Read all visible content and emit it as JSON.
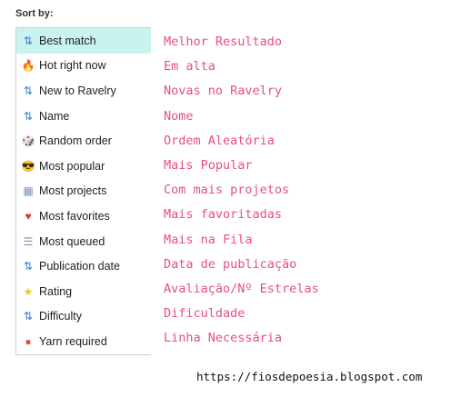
{
  "sort": {
    "label": "Sort by:",
    "selected_index": 0,
    "options": [
      {
        "label": "Best match",
        "icon": "best-match-icon",
        "glyph": "⇅"
      },
      {
        "label": "Hot right now",
        "icon": "fire-icon",
        "glyph": "🔥"
      },
      {
        "label": "New to Ravelry",
        "icon": "new-sort-icon",
        "glyph": "⇅"
      },
      {
        "label": "Name",
        "icon": "alpha-sort-icon",
        "glyph": "⇅"
      },
      {
        "label": "Random order",
        "icon": "dice-icon",
        "glyph": "🎲"
      },
      {
        "label": "Most popular",
        "icon": "sunglasses-face-icon",
        "glyph": "😎"
      },
      {
        "label": "Most projects",
        "icon": "projects-icon",
        "glyph": "▦"
      },
      {
        "label": "Most favorites",
        "icon": "heart-icon",
        "glyph": "♥"
      },
      {
        "label": "Most queued",
        "icon": "queue-icon",
        "glyph": "☰"
      },
      {
        "label": "Publication date",
        "icon": "date-sort-icon",
        "glyph": "⇅"
      },
      {
        "label": "Rating",
        "icon": "star-icon",
        "glyph": "★"
      },
      {
        "label": "Difficulty",
        "icon": "difficulty-sort-icon",
        "glyph": "⇅"
      },
      {
        "label": "Yarn required",
        "icon": "yarn-ball-icon",
        "glyph": "●"
      }
    ]
  },
  "translations": [
    "Melhor Resultado",
    "Em alta",
    "Novas no Ravelry",
    "Nome",
    "Ordem Aleatória",
    "Mais Popular",
    "Com mais projetos",
    "Mais favoritadas",
    "Mais na Fila",
    "Data de publicação",
    "Avaliação/Nº Estrelas",
    "Dificuldade",
    "Linha Necessária"
  ],
  "source_url": "https://fiosdepoesia.blogspot.com",
  "colors": {
    "selected_bg": "#c8f3ee",
    "translation_text": "#e8507a",
    "sort_icon_blue": "#3b7fd9",
    "fire": "#f05a28",
    "heart": "#e0313c",
    "star": "#f5c518",
    "yarn": "#e8453c"
  }
}
